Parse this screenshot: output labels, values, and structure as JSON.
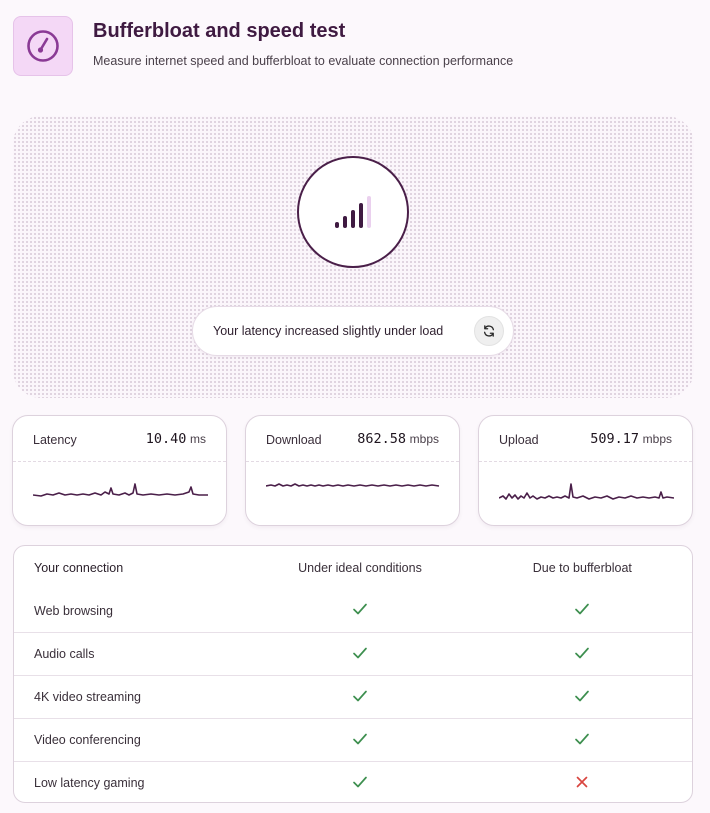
{
  "header": {
    "title": "Bufferbloat and speed test",
    "subtitle": "Measure internet speed and bufferbloat to evaluate connection performance",
    "icon": "speedometer-icon"
  },
  "hero": {
    "status_text": "Your latency increased slightly under load",
    "refresh_icon": "refresh-icon",
    "signal_icon": "signal-bars-icon",
    "signal_level_bars": 4,
    "signal_total_bars": 5
  },
  "metrics": [
    {
      "label": "Latency",
      "value": "10.40",
      "unit": "ms"
    },
    {
      "label": "Download",
      "value": "862.58",
      "unit": "mbps"
    },
    {
      "label": "Upload",
      "value": "509.17",
      "unit": "mbps"
    }
  ],
  "table": {
    "headers": [
      "Your connection",
      "Under ideal conditions",
      "Due to bufferbloat"
    ],
    "rows": [
      {
        "label": "Web browsing",
        "ideal": "check",
        "bufferbloat": "check"
      },
      {
        "label": "Audio calls",
        "ideal": "check",
        "bufferbloat": "check"
      },
      {
        "label": "4K video streaming",
        "ideal": "check",
        "bufferbloat": "check"
      },
      {
        "label": "Video conferencing",
        "ideal": "check",
        "bufferbloat": "check"
      },
      {
        "label": "Low latency gaming",
        "ideal": "check",
        "bufferbloat": "cross"
      }
    ]
  },
  "colors": {
    "accent": "#4a1f49",
    "accent_light": "#f4d8f6",
    "check": "#3d8f4f",
    "cross": "#d9453f"
  }
}
